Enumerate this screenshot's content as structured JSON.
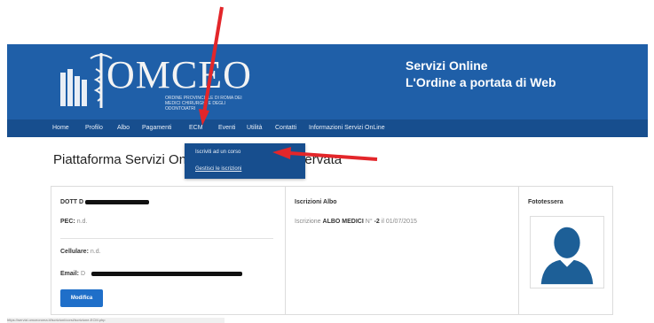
{
  "header": {
    "logo_text": "OMCEO",
    "logo_subtitle": "ORDINE PROVINCIALE DI ROMA DEI MEDICI CHIRURGHI E DEGLI ODONTOIATRI",
    "tagline_line1": "Servizi Online",
    "tagline_line2": "L'Ordine a portata di Web",
    "brand_color": "#1f5fa8"
  },
  "nav": {
    "items": [
      "Home",
      "Profilo",
      "Albo",
      "Pagamenti",
      "ECM",
      "Eventi",
      "Utilità",
      "Contatti",
      "Informazioni Servizi OnLine"
    ]
  },
  "dropdown": {
    "items": [
      "Iscriviti ad un corso",
      "Gestisci le iscrizioni"
    ]
  },
  "page": {
    "title_start": "Piattaforma Servizi Onl",
    "title_end": "ervata"
  },
  "profile": {
    "name_prefix": "DOTT D",
    "pec_label": "PEC:",
    "pec_value": "n.d.",
    "cellulare_label": "Cellulare:",
    "cellulare_value": "n.d.",
    "email_label": "Email:",
    "email_value": "D",
    "edit_button": "Modifica"
  },
  "iscrizioni": {
    "title": "Iscrizioni Albo",
    "text_prefix": "Iscrizione",
    "albo": "ALBO MEDICI",
    "number_label": "N°",
    "number": "-2",
    "date": "il 01/07/2015"
  },
  "fototessera": {
    "title": "Fototessera"
  },
  "statusbar": {
    "url": "https://servizi.omceoroma.it/iscrizioni/corsi/iscrizione-ECM.php"
  },
  "icons": {
    "logo": "caduceus-icon",
    "avatar": "user-silhouette-icon"
  },
  "annotation_color": "#e3262a"
}
